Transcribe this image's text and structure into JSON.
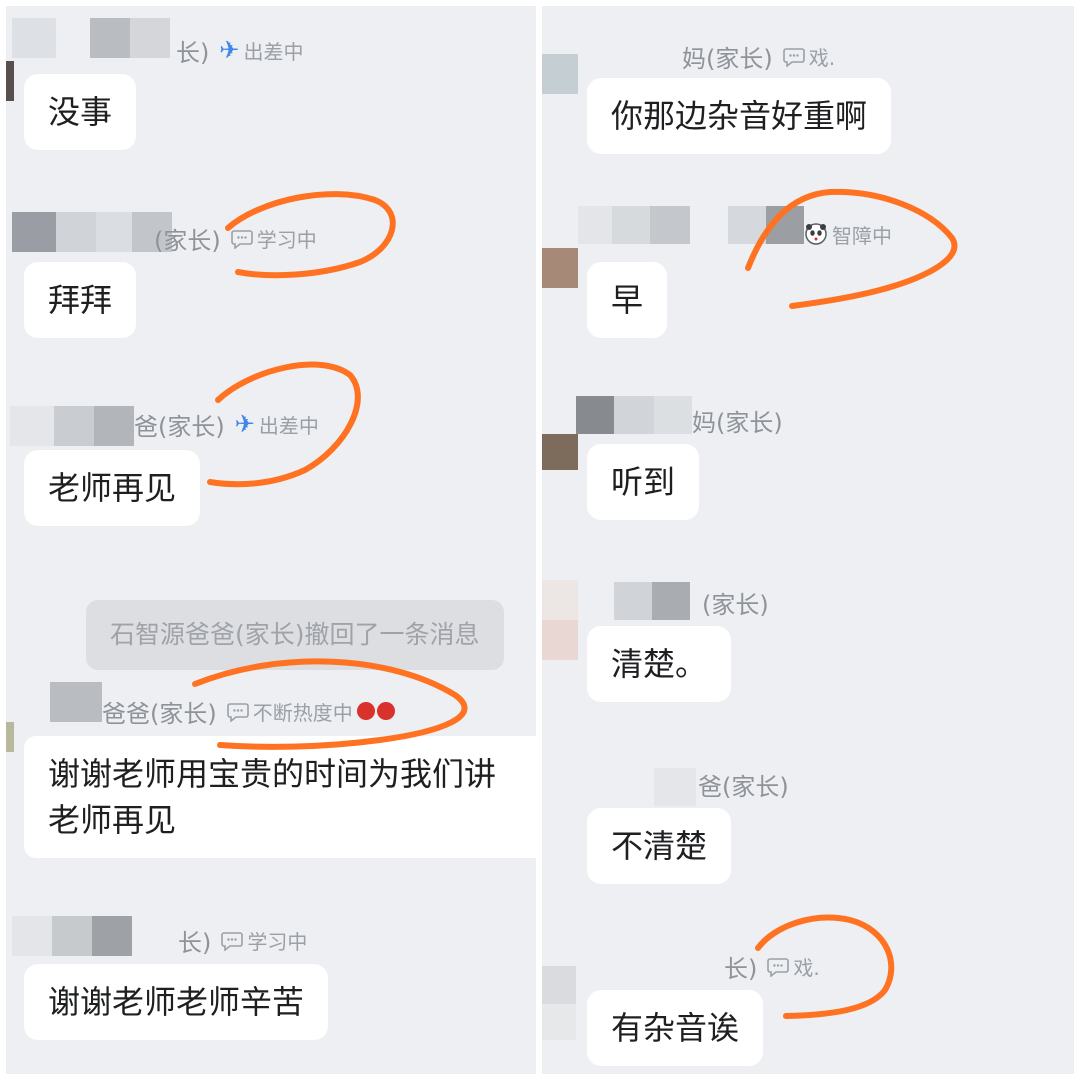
{
  "left_panel": {
    "messages": [
      {
        "sender": "长)",
        "status_icon": "airplane-icon",
        "status": "出差中",
        "text": "没事"
      },
      {
        "sender": "(家长)",
        "status_icon": "speech-bubble-icon",
        "status": "学习中",
        "text": "拜拜"
      },
      {
        "sender": "爸(家长)",
        "status_icon": "airplane-icon",
        "status": "出差中",
        "text": "老师再见"
      },
      {
        "sender": "爸爸(家长)",
        "status_icon": "speech-bubble-icon",
        "status": "不断热度中",
        "text": "谢谢老师用宝贵的时间为我们讲",
        "text2": "老师再见"
      },
      {
        "sender": "长)",
        "status_icon": "speech-bubble-icon",
        "status": "学习中",
        "text": "谢谢老师老师辛苦"
      }
    ],
    "recall_notice": "石智源爸爸(家长)撤回了一条消息"
  },
  "right_panel": {
    "messages": [
      {
        "sender": "妈(家长)",
        "status_icon": "speech-bubble-icon",
        "status": "戏.",
        "text": "你那边杂音好重啊"
      },
      {
        "sender": "",
        "status_icon": "panda-icon",
        "status": "智障中",
        "text": "早"
      },
      {
        "sender": "妈(家长)",
        "status": "",
        "text": "听到"
      },
      {
        "sender": "(家长)",
        "status": "",
        "text": "清楚。"
      },
      {
        "sender": "爸(家长)",
        "status": "",
        "text": "不清楚"
      },
      {
        "sender": "长)",
        "status_icon": "speech-bubble-icon",
        "status": "戏.",
        "text": "有杂音诶"
      }
    ]
  },
  "colors": {
    "annotation": "#ff7222",
    "panel_bg": "#edeff2",
    "bubble_bg": "#ffffff",
    "airplane": "#3f86e8"
  }
}
